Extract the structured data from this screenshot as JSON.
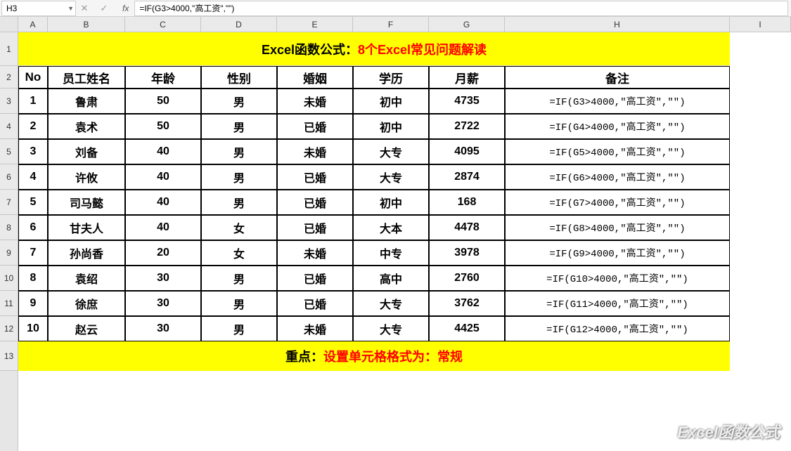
{
  "nameBox": "H3",
  "formula": "=IF(G3>4000,\"高工资\",\"\")",
  "colHeaders": [
    "A",
    "B",
    "C",
    "D",
    "E",
    "F",
    "G",
    "H",
    "I"
  ],
  "rowHeaders": [
    "1",
    "2",
    "3",
    "4",
    "5",
    "6",
    "7",
    "8",
    "9",
    "10",
    "11",
    "12",
    "13"
  ],
  "title": {
    "prefix": "Excel函数公式：",
    "suffix": "8个Excel常见问题解读"
  },
  "tableHeaders": [
    "No",
    "员工姓名",
    "年龄",
    "性别",
    "婚姻",
    "学历",
    "月薪",
    "备注"
  ],
  "rows": [
    {
      "no": "1",
      "name": "鲁肃",
      "age": "50",
      "gender": "男",
      "marital": "未婚",
      "edu": "初中",
      "salary": "4735",
      "formula": "=IF(G3>4000,\"高工资\",\"\")"
    },
    {
      "no": "2",
      "name": "袁术",
      "age": "50",
      "gender": "男",
      "marital": "已婚",
      "edu": "初中",
      "salary": "2722",
      "formula": "=IF(G4>4000,\"高工资\",\"\")"
    },
    {
      "no": "3",
      "name": "刘备",
      "age": "40",
      "gender": "男",
      "marital": "未婚",
      "edu": "大专",
      "salary": "4095",
      "formula": "=IF(G5>4000,\"高工资\",\"\")"
    },
    {
      "no": "4",
      "name": "许攸",
      "age": "40",
      "gender": "男",
      "marital": "已婚",
      "edu": "大专",
      "salary": "2874",
      "formula": "=IF(G6>4000,\"高工资\",\"\")"
    },
    {
      "no": "5",
      "name": "司马懿",
      "age": "40",
      "gender": "男",
      "marital": "已婚",
      "edu": "初中",
      "salary": "168",
      "formula": "=IF(G7>4000,\"高工资\",\"\")"
    },
    {
      "no": "6",
      "name": "甘夫人",
      "age": "40",
      "gender": "女",
      "marital": "已婚",
      "edu": "大本",
      "salary": "4478",
      "formula": "=IF(G8>4000,\"高工资\",\"\")"
    },
    {
      "no": "7",
      "name": "孙尚香",
      "age": "20",
      "gender": "女",
      "marital": "未婚",
      "edu": "中专",
      "salary": "3978",
      "formula": "=IF(G9>4000,\"高工资\",\"\")"
    },
    {
      "no": "8",
      "name": "袁绍",
      "age": "30",
      "gender": "男",
      "marital": "已婚",
      "edu": "高中",
      "salary": "2760",
      "formula": "=IF(G10>4000,\"高工资\",\"\")"
    },
    {
      "no": "9",
      "name": "徐庶",
      "age": "30",
      "gender": "男",
      "marital": "已婚",
      "edu": "大专",
      "salary": "3762",
      "formula": "=IF(G11>4000,\"高工资\",\"\")"
    },
    {
      "no": "10",
      "name": "赵云",
      "age": "30",
      "gender": "男",
      "marital": "未婚",
      "edu": "大专",
      "salary": "4425",
      "formula": "=IF(G12>4000,\"高工资\",\"\")"
    }
  ],
  "footer": {
    "prefix": "重点：",
    "suffix": "设置单元格格式为：常规"
  },
  "fxLabel": "fx",
  "watermark": "Excel函数公式"
}
